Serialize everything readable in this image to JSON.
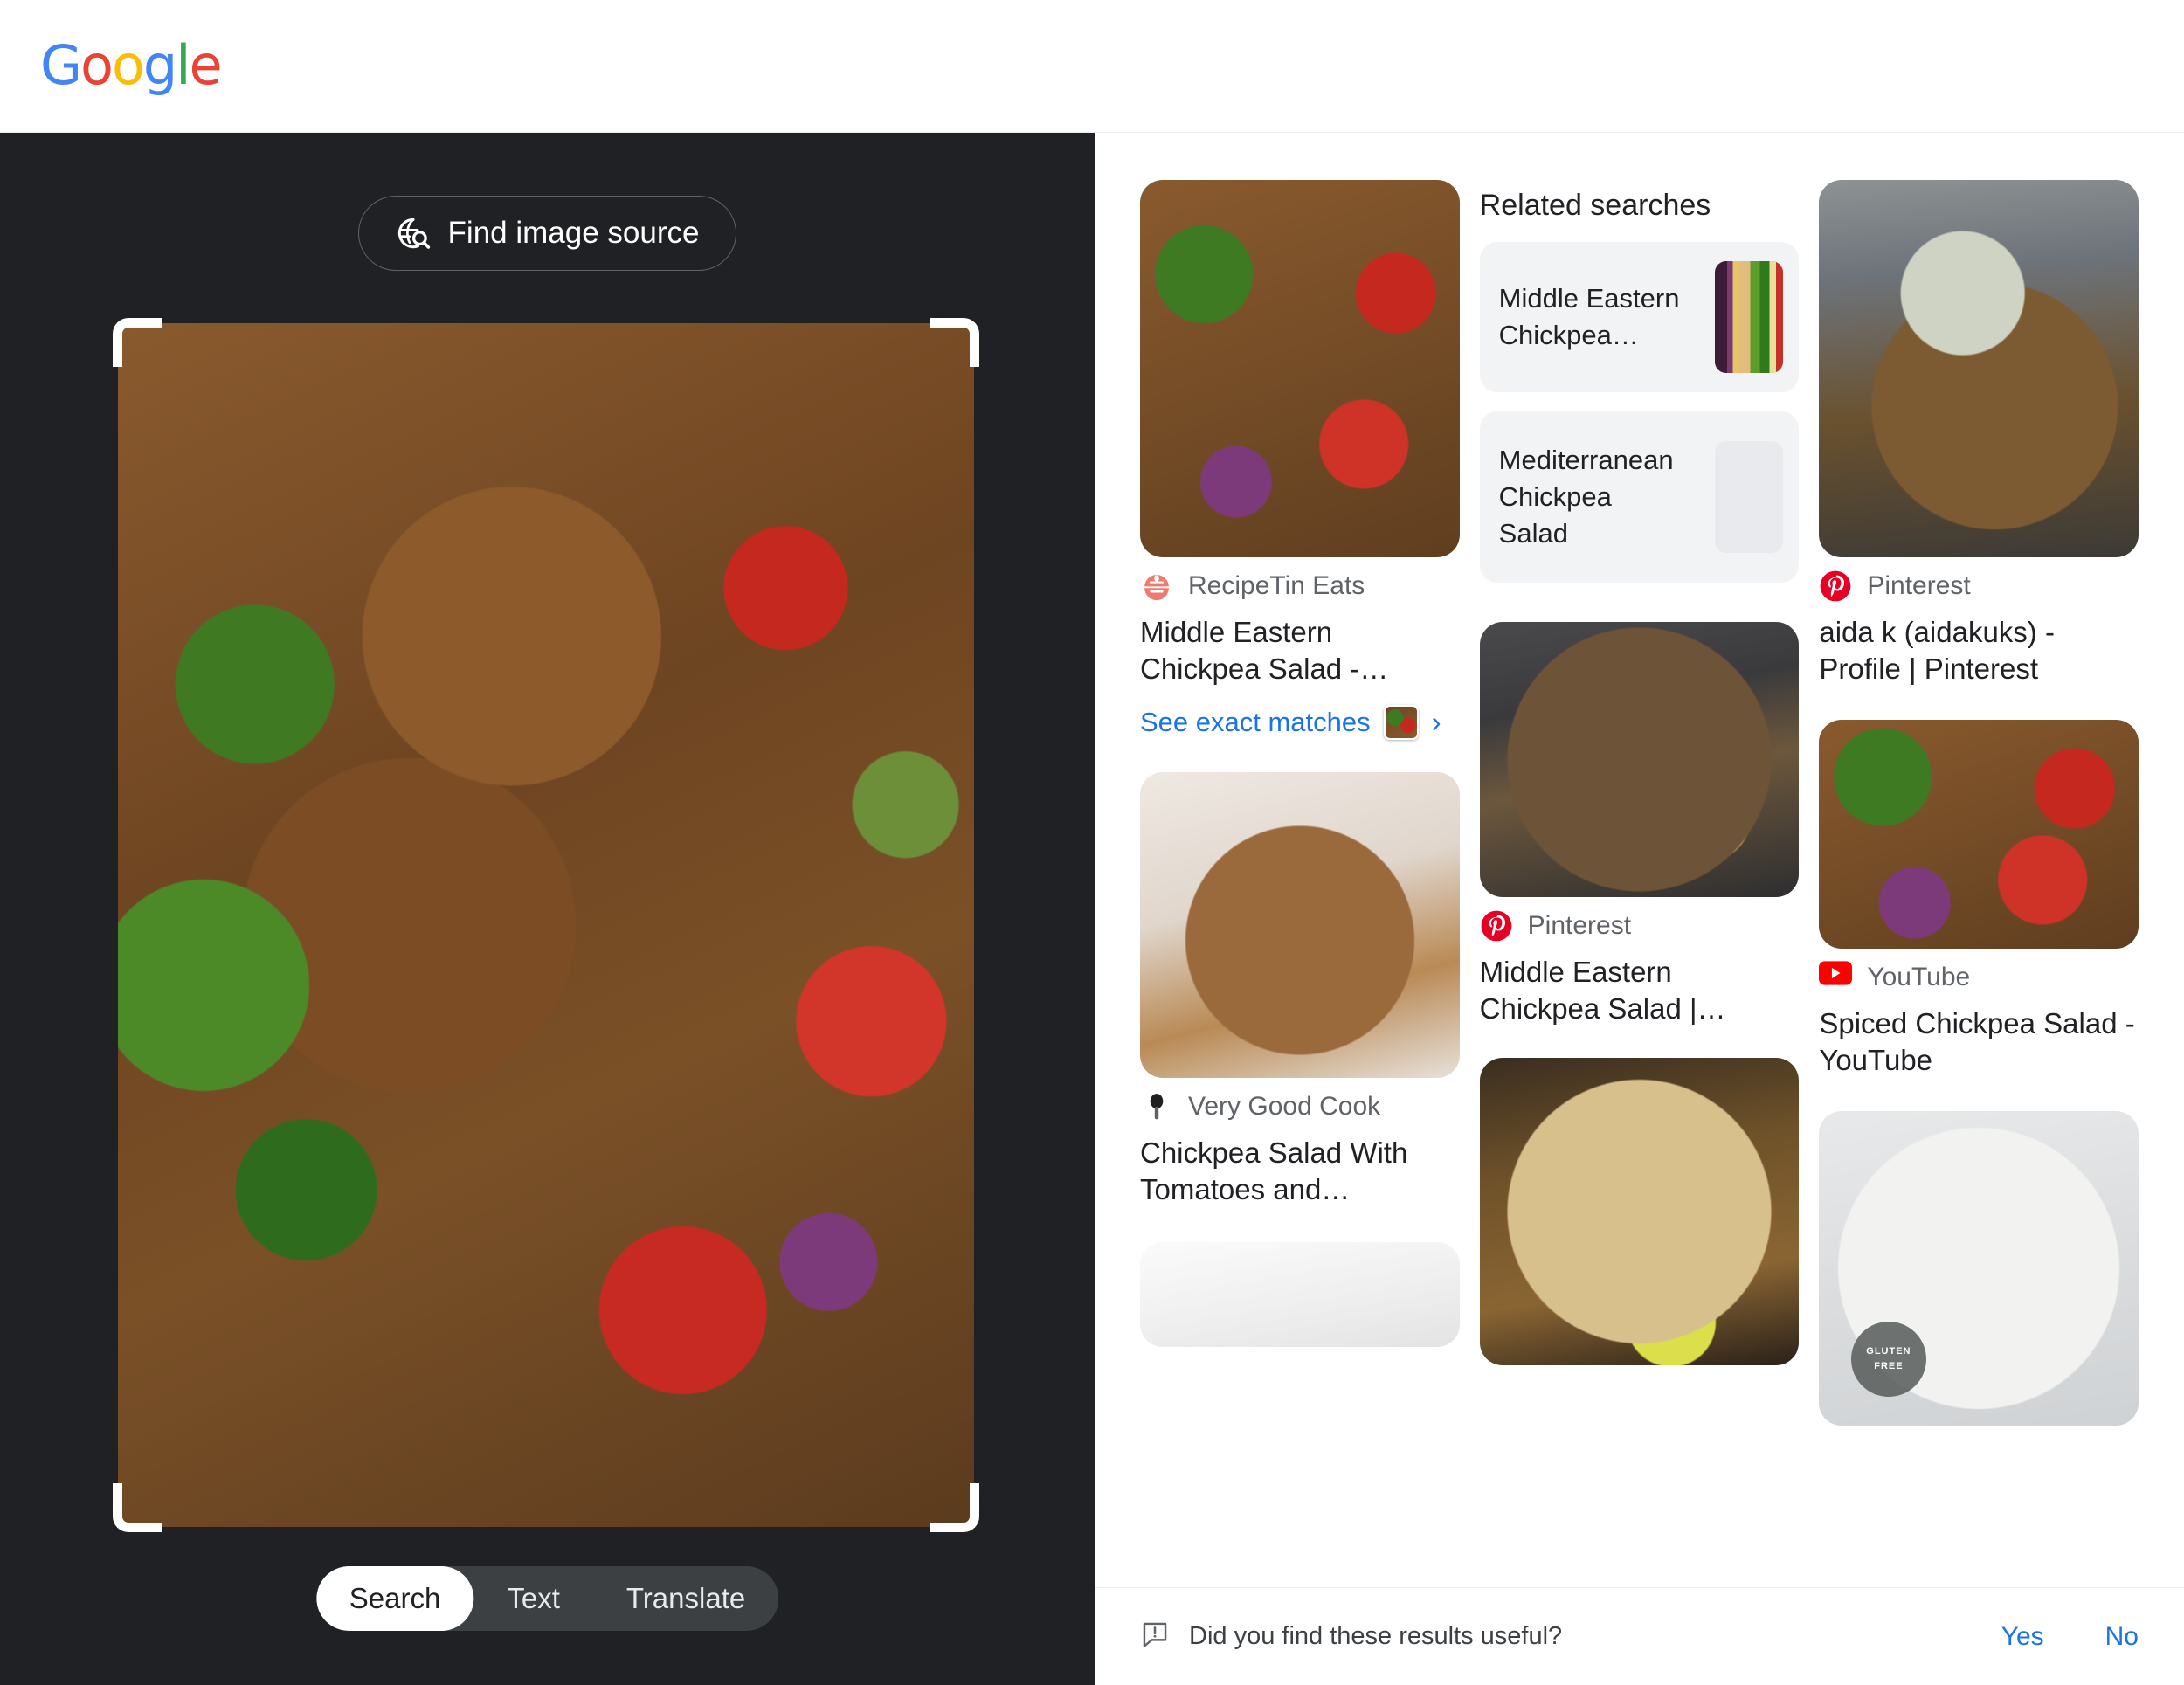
{
  "brand": {
    "name": "Google",
    "letters": [
      {
        "ch": "G",
        "color": "#4285F4"
      },
      {
        "ch": "o",
        "color": "#EA4335"
      },
      {
        "ch": "o",
        "color": "#FBBC05"
      },
      {
        "ch": "g",
        "color": "#4285F4"
      },
      {
        "ch": "l",
        "color": "#34A853"
      },
      {
        "ch": "e",
        "color": "#EA4335"
      }
    ]
  },
  "colors": {
    "accent_blue": "#1a73e8",
    "panel_dark": "#202124",
    "modebar_bg": "#3c4043",
    "chip_bg": "#f1f3f4",
    "pinterest_red": "#E60023",
    "youtube_red": "#FF0000",
    "recipetin_coral": "#F07A6E"
  },
  "image_panel": {
    "find_source_label": "Find image source",
    "find_source_icon": "globe-search-icon",
    "crop_handles": [
      "top-left",
      "top-right",
      "bottom-left",
      "bottom-right"
    ],
    "photo_alt": "Middle Eastern chickpea salad with tomatoes, cucumber, red onion and parsley",
    "modes": [
      {
        "label": "Search",
        "active": true
      },
      {
        "label": "Text",
        "active": false
      },
      {
        "label": "Translate",
        "active": false
      }
    ]
  },
  "results": {
    "related_searches": {
      "heading": "Related searches",
      "chips": [
        {
          "label": "Middle Eastern Chickpea…",
          "has_thumb": true
        },
        {
          "label": "Mediterranean Chickpea Salad",
          "has_thumb": false
        }
      ]
    },
    "cards": [
      {
        "id": "recipetin",
        "source": "RecipeTin Eats",
        "favicon": "recipetin-eats-icon",
        "title": "Middle Eastern Chickpea Salad -…",
        "exact_matches_label": "See exact matches",
        "chevron": "chevron-right-icon"
      },
      {
        "id": "pinterest-profile",
        "source": "Pinterest",
        "favicon": "pinterest-icon",
        "title": "aida k (aidakuks) - Profile | Pinterest"
      },
      {
        "id": "pinterest-salad",
        "source": "Pinterest",
        "favicon": "pinterest-icon",
        "title": "Middle Eastern Chickpea Salad |…"
      },
      {
        "id": "youtube",
        "source": "YouTube",
        "favicon": "youtube-icon",
        "title": "Spiced Chickpea Salad - YouTube"
      },
      {
        "id": "verygoodcook",
        "source": "Very Good Cook",
        "favicon": "very-good-cook-icon",
        "title": "Chickpea Salad With Tomatoes and…"
      }
    ],
    "gluten_badge": {
      "line1": "GLUTEN",
      "line2": "FREE"
    }
  },
  "feedback": {
    "icon": "feedback-icon",
    "question": "Did you find these results useful?",
    "yes_label": "Yes",
    "no_label": "No"
  }
}
